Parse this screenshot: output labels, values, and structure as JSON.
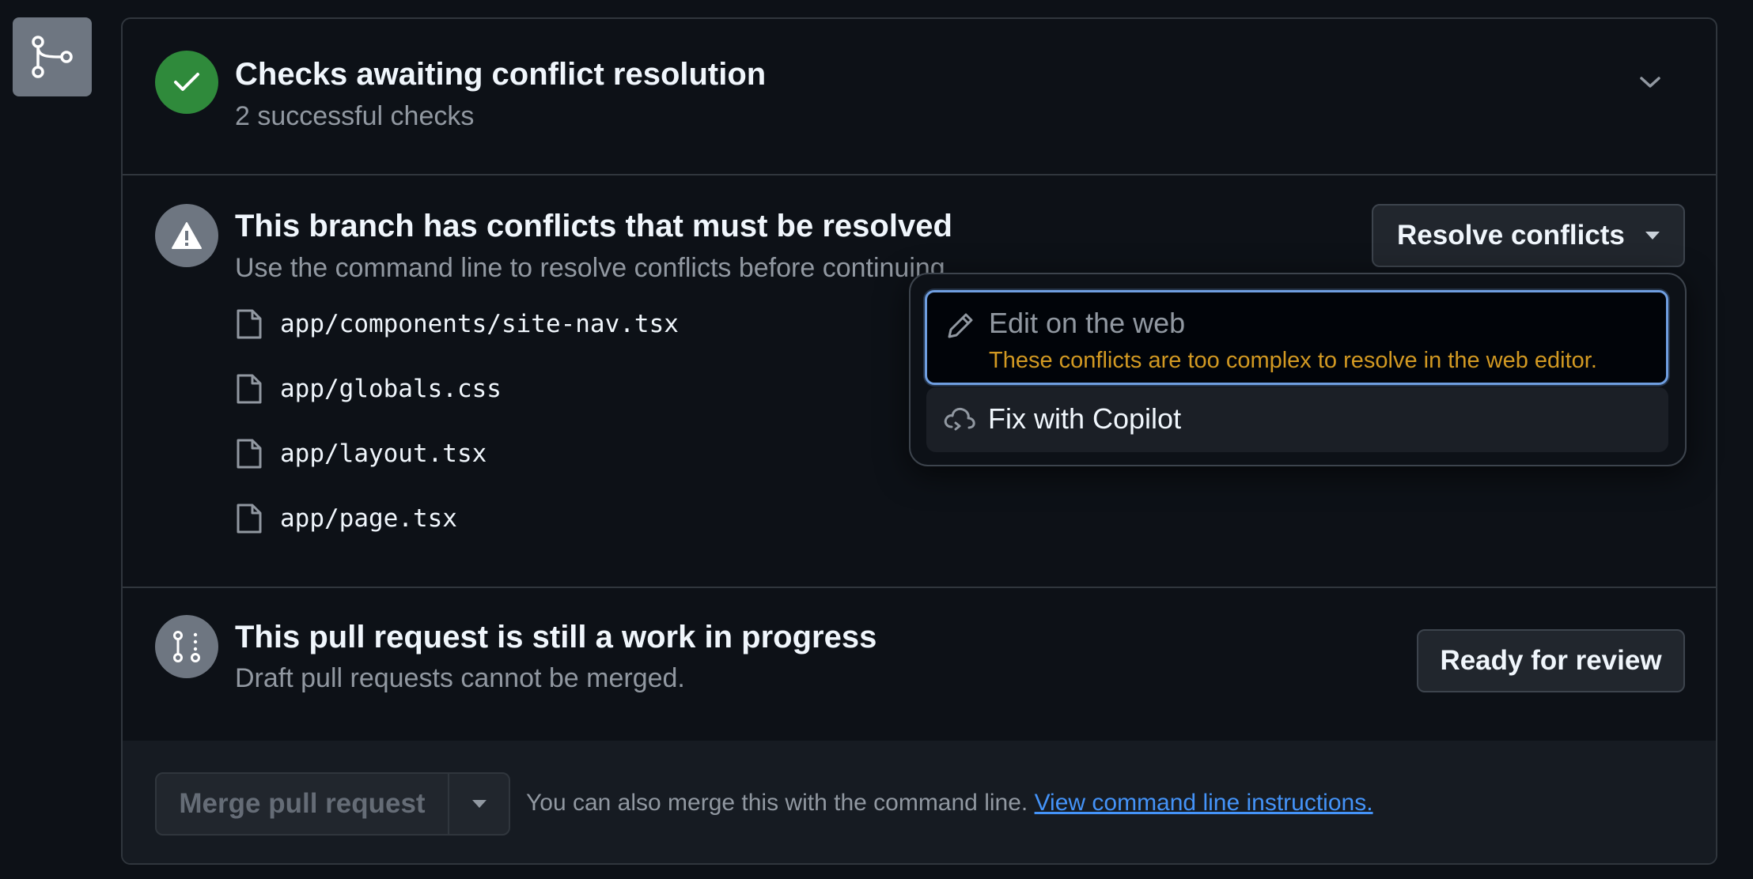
{
  "checks": {
    "title": "Checks awaiting conflict resolution",
    "subtitle": "2 successful checks"
  },
  "conflicts": {
    "title": "This branch has conflicts that must be resolved",
    "subtitle": "Use the command line to resolve conflicts before continuing.",
    "button_label": "Resolve conflicts",
    "files": [
      "app/components/site-nav.tsx",
      "app/globals.css",
      "app/layout.tsx",
      "app/page.tsx"
    ]
  },
  "menu": {
    "edit_label": "Edit on the web",
    "edit_warning": "These conflicts are too complex to resolve in the web editor.",
    "copilot_label": "Fix with Copilot"
  },
  "wip": {
    "title": "This pull request is still a work in progress",
    "subtitle": "Draft pull requests cannot be merged.",
    "button_label": "Ready for review"
  },
  "merge": {
    "button_label": "Merge pull request",
    "text": "You can also merge this with the command line.",
    "link": "View command line instructions."
  }
}
